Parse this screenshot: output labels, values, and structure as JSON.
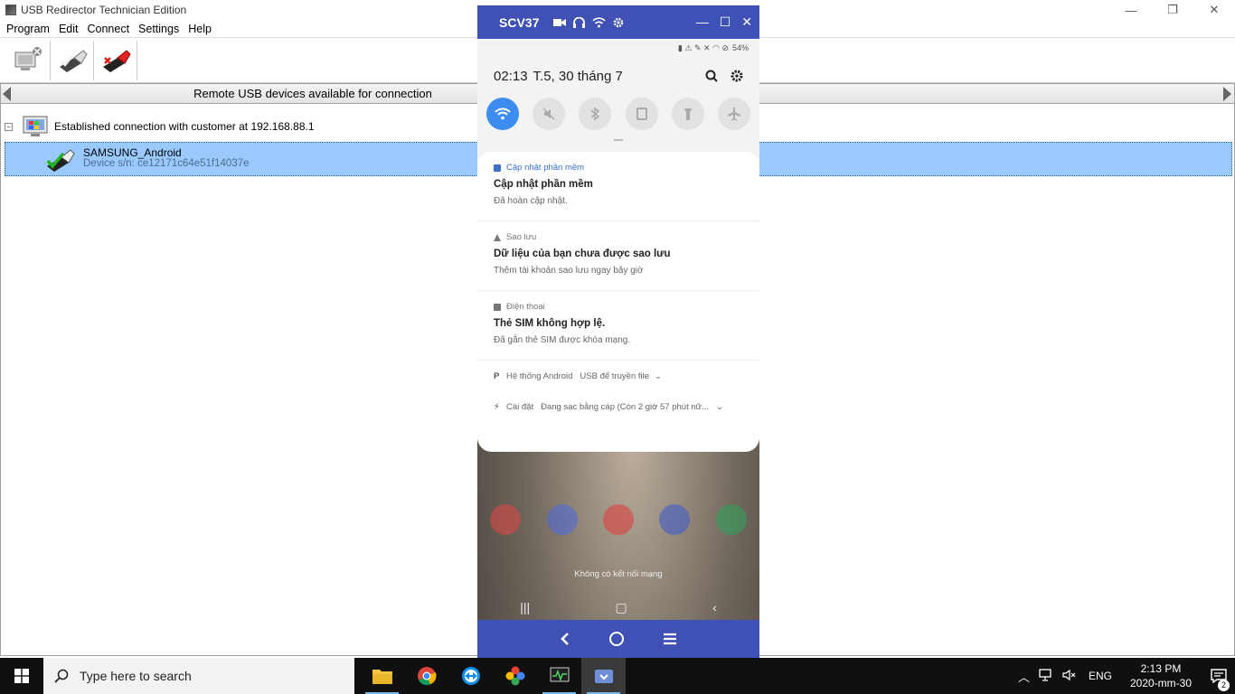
{
  "app": {
    "title": "USB Redirector Technician Edition",
    "menu": [
      "Program",
      "Edit",
      "Connect",
      "Settings",
      "Help"
    ],
    "list_header": "Remote USB devices available for connection",
    "connection_label": "Established connection with customer at 192.168.88.1",
    "device_name": "SAMSUNG_Android",
    "device_sn": "Device s/n: ce12171c64e51f14037e"
  },
  "phone": {
    "window_title": "SCV37",
    "status_right": "54%",
    "time": "02:13",
    "date": "T.5, 30 tháng 7",
    "notifications": [
      {
        "source": "Cập nhật phần mềm",
        "title": "Cập nhật phần mềm",
        "desc": "Đã hoàn cập nhật."
      },
      {
        "source": "Sao lưu",
        "title": "Dữ liệu của bạn chưa được sao lưu",
        "desc": "Thêm tài khoản sao lưu ngay bây giờ"
      },
      {
        "source": "Điện thoại",
        "title": "Thẻ SIM không hợp lệ.",
        "desc": "Đã gắn thẻ SIM được khóa mạng."
      }
    ],
    "mini_notifications": [
      {
        "source": "Hệ thống Android",
        "text": "USB để truyền file"
      },
      {
        "source": "Cài đặt",
        "text": "Đang sạc bằng cáp (Còn 2 giờ 57 phút nữ..."
      }
    ],
    "home_message": "Không có kết nối mạng"
  },
  "taskbar": {
    "search_placeholder": "Type here to search",
    "lang": "ENG",
    "time": "2:13 PM",
    "date": "2020-mm-30",
    "notif_count": "2"
  },
  "colors": {
    "phone_accent": "#3f51b5",
    "selection": "#99c9ff",
    "wifi_tile": "#3d8df1"
  }
}
